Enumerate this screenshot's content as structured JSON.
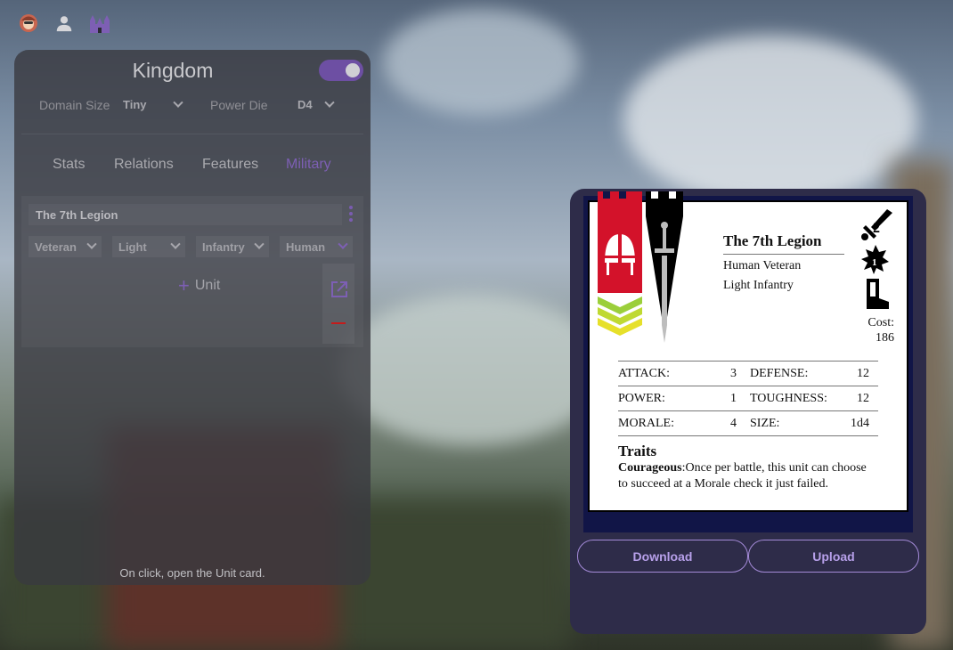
{
  "topbar": {
    "icons": [
      "avatar-icon",
      "person-icon",
      "castle-icon"
    ]
  },
  "kingdom": {
    "title": "Kingdom",
    "toggle_on": true,
    "domain_size_label": "Domain Size",
    "domain_size_value": "Tiny",
    "power_die_label": "Power Die",
    "power_die_value": "D4",
    "tabs": [
      "Stats",
      "Relations",
      "Features",
      "Military"
    ],
    "active_tab": "Military",
    "unit": {
      "name": "The 7th Legion",
      "experience": "Veteran",
      "equipment": "Light",
      "type": "Infantry",
      "ancestry": "Human"
    },
    "add_unit_label": "Unit",
    "hint": "On click, open the Unit card."
  },
  "card": {
    "name": "The 7th Legion",
    "line1": "Human Veteran",
    "line2": "Light Infantry",
    "cost_label": "Cost:",
    "cost_value": "186",
    "stats": {
      "attack_label": "ATTACK:",
      "attack": "3",
      "defense_label": "DEFENSE:",
      "defense": "12",
      "power_label": "POWER:",
      "power": "1",
      "toughness_label": "TOUGHNESS:",
      "toughness": "12",
      "morale_label": "MORALE:",
      "morale": "4",
      "size_label": "SIZE:",
      "size": "1d4"
    },
    "traits_heading": "Traits",
    "trait_name": "Courageous",
    "trait_text": ":Once per battle, this unit can choose to succeed at a Morale check it just failed.",
    "download_label": "Download",
    "upload_label": "Upload"
  },
  "colors": {
    "accent": "#7d5fb4",
    "card_border": "#111547",
    "card_panel": "#2e2c49",
    "banner_red": "#d3122a",
    "chevron_green": "#9bcf3a"
  }
}
